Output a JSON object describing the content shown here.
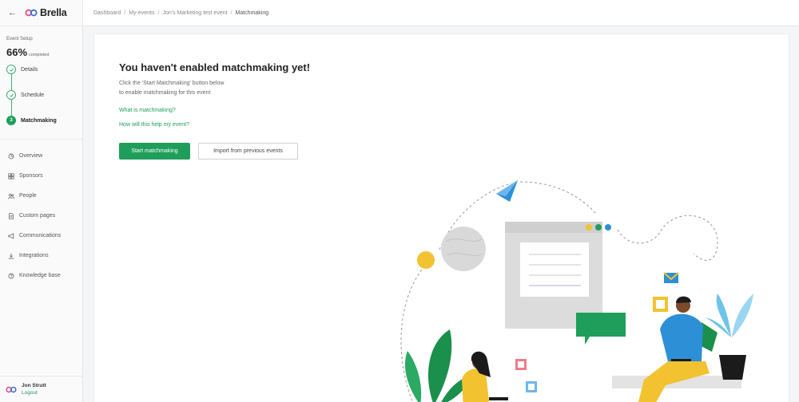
{
  "app": {
    "name": "Brella"
  },
  "sidebar": {
    "setup_label": "Event Setup",
    "progress_value": "66%",
    "progress_suffix": "completed",
    "steps": [
      {
        "label": "Details",
        "state": "done"
      },
      {
        "label": "Schedule",
        "state": "done"
      },
      {
        "number": "3",
        "label": "Matchmaking",
        "state": "current"
      }
    ],
    "nav": [
      {
        "label": "Overview",
        "icon": "pie-chart-icon"
      },
      {
        "label": "Sponsors",
        "icon": "grid-icon"
      },
      {
        "label": "People",
        "icon": "people-icon"
      },
      {
        "label": "Custom pages",
        "icon": "page-icon"
      },
      {
        "label": "Communications",
        "icon": "megaphone-icon"
      },
      {
        "label": "Integrations",
        "icon": "download-icon"
      },
      {
        "label": "Knowledge base",
        "icon": "help-icon"
      }
    ],
    "user": {
      "name": "Jon Strutt",
      "logout": "Logout"
    }
  },
  "breadcrumb": [
    "Dashboard",
    "My-events",
    "Jon's Marketing test event",
    "Matchmaking"
  ],
  "main": {
    "title": "You haven't enabled matchmaking yet!",
    "description_line1": "Click the 'Start Matchmaking' button below",
    "description_line2": "to enable matchmaking for this event",
    "link1": "What is matchmaking?",
    "link2": "How will this help my event?",
    "start_button": "Start matchmaking",
    "import_button": "Import from previous events"
  },
  "colors": {
    "accent": "#1e9e5a",
    "yellow": "#f2c230",
    "blue": "#2d8fd6"
  }
}
